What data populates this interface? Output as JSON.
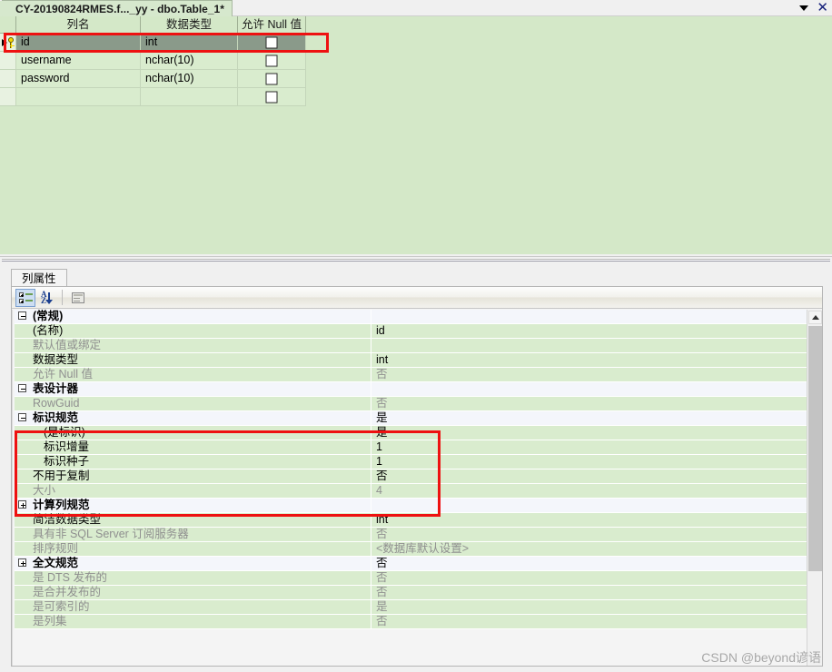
{
  "window": {
    "tab_title": "CY-20190824RMES.f..._yy - dbo.Table_1*",
    "dropdown_icon": "chevron-down-icon",
    "close_icon": "close-icon"
  },
  "designer": {
    "columns": [
      "列名",
      "数据类型",
      "允许 Null 值"
    ],
    "rows": [
      {
        "name": "id",
        "type": "int",
        "allow_null": false,
        "selected": true,
        "primary_key": true
      },
      {
        "name": "username",
        "type": "nchar(10)",
        "allow_null": false,
        "selected": false,
        "primary_key": false
      },
      {
        "name": "password",
        "type": "nchar(10)",
        "allow_null": false,
        "selected": false,
        "primary_key": false
      },
      {
        "name": "",
        "type": "",
        "allow_null": false,
        "selected": false,
        "primary_key": false
      }
    ]
  },
  "properties": {
    "tab_label": "列属性",
    "toolbar": {
      "categorized": "categorized-view-icon",
      "alphabetical": "alphabetical-sort-icon",
      "property_pages": "property-pages-icon"
    },
    "rows": [
      {
        "label": "(常规)",
        "value": "",
        "kind": "category",
        "expanded": true,
        "dim": false,
        "indent": 0
      },
      {
        "label": "(名称)",
        "value": "id",
        "kind": "prop",
        "dim": false,
        "indent": 1
      },
      {
        "label": "默认值或绑定",
        "value": "",
        "kind": "prop",
        "dim": true,
        "indent": 1
      },
      {
        "label": "数据类型",
        "value": "int",
        "kind": "prop",
        "dim": false,
        "indent": 1
      },
      {
        "label": "允许 Null 值",
        "value": "否",
        "kind": "prop",
        "dim": true,
        "indent": 1
      },
      {
        "label": "表设计器",
        "value": "",
        "kind": "category",
        "expanded": true,
        "dim": false,
        "indent": 0
      },
      {
        "label": "RowGuid",
        "value": "否",
        "kind": "prop",
        "dim": true,
        "indent": 1
      },
      {
        "label": "标识规范",
        "value": "是",
        "kind": "category",
        "expanded": true,
        "dim": false,
        "indent": 0
      },
      {
        "label": "(是标识)",
        "value": "是",
        "kind": "prop",
        "dim": false,
        "indent": 2
      },
      {
        "label": "标识增量",
        "value": "1",
        "kind": "prop",
        "dim": false,
        "indent": 2
      },
      {
        "label": "标识种子",
        "value": "1",
        "kind": "prop",
        "dim": false,
        "indent": 2
      },
      {
        "label": "不用于复制",
        "value": "否",
        "kind": "prop",
        "dim": false,
        "indent": 1
      },
      {
        "label": "大小",
        "value": "4",
        "kind": "prop",
        "dim": true,
        "indent": 1
      },
      {
        "label": "计算列规范",
        "value": "",
        "kind": "category",
        "expanded": false,
        "dim": false,
        "indent": 0
      },
      {
        "label": "简洁数据类型",
        "value": "int",
        "kind": "prop",
        "dim": false,
        "indent": 1
      },
      {
        "label": "具有非 SQL Server 订阅服务器",
        "value": "否",
        "kind": "prop",
        "dim": true,
        "indent": 1
      },
      {
        "label": "排序规则",
        "value": "<数据库默认设置>",
        "kind": "prop",
        "dim": true,
        "indent": 1
      },
      {
        "label": "全文规范",
        "value": "否",
        "kind": "category",
        "expanded": false,
        "dim": false,
        "indent": 0
      },
      {
        "label": "是 DTS 发布的",
        "value": "否",
        "kind": "prop",
        "dim": true,
        "indent": 1
      },
      {
        "label": "是合并发布的",
        "value": "否",
        "kind": "prop",
        "dim": true,
        "indent": 1
      },
      {
        "label": "是可索引的",
        "value": "是",
        "kind": "prop",
        "dim": true,
        "indent": 1
      },
      {
        "label": "是列集",
        "value": "否",
        "kind": "prop",
        "dim": true,
        "indent": 1
      }
    ]
  },
  "watermark": {
    "text": "CSDN @beyond谚语"
  },
  "colors": {
    "grid_bg": "#d9ecce",
    "selected_row": "#8a9a8a",
    "highlight_box": "#ee1111",
    "category_bg": "#f4f6fb"
  }
}
